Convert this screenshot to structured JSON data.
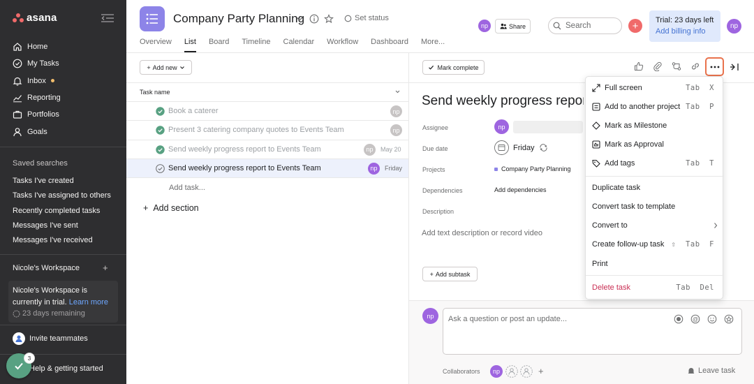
{
  "sidebar": {
    "logo_text": "asana",
    "nav": [
      {
        "label": "Home",
        "icon": "home-icon"
      },
      {
        "label": "My Tasks",
        "icon": "check-circle-icon"
      },
      {
        "label": "Inbox",
        "icon": "bell-icon"
      },
      {
        "label": "Reporting",
        "icon": "chart-icon"
      },
      {
        "label": "Portfolios",
        "icon": "portfolio-icon"
      },
      {
        "label": "Goals",
        "icon": "person-icon"
      }
    ],
    "saved_searches_title": "Saved searches",
    "saved_searches": [
      "Tasks I've created",
      "Tasks I've assigned to others",
      "Recently completed tasks",
      "Messages I've sent",
      "Messages I've received"
    ],
    "workspace_title": "Nicole's Workspace",
    "trial_text_1": "Nicole's Workspace is",
    "trial_text_2": "currently in trial.",
    "learn_more": "Learn more",
    "days_remaining": "23 days remaining",
    "invite": "Invite teammates",
    "help": "Help & getting started",
    "check_badge": "3"
  },
  "header": {
    "project_title": "Company Party Planning",
    "set_status": "Set status",
    "tabs": [
      "Overview",
      "List",
      "Board",
      "Timeline",
      "Calendar",
      "Workflow",
      "Dashboard",
      "More..."
    ],
    "active_tab": "List",
    "avatar_initials": "np",
    "share": "Share",
    "search_placeholder": "Search",
    "trial_line": "Trial: 23 days left",
    "billing_link": "Add billing info"
  },
  "list": {
    "add_new": "Add new",
    "column_header": "Task name",
    "tasks": [
      {
        "name": "Book a caterer",
        "avatar": "np",
        "date": ""
      },
      {
        "name": "Present 3 catering company quotes to Events Team",
        "avatar": "np",
        "date": ""
      },
      {
        "name": "Send weekly progress report to Events Team",
        "avatar": "np",
        "date": "May 20"
      },
      {
        "name": "Send weekly progress report to Events Team",
        "avatar": "np",
        "date": "Friday"
      }
    ],
    "add_task": "Add task...",
    "add_section": "Add section"
  },
  "detail": {
    "mark_complete": "Mark complete",
    "title": "Send weekly progress report to Events Team",
    "assignee_label": "Assignee",
    "assignee_avatar": "np",
    "due_label": "Due date",
    "due_value": "Friday",
    "projects_label": "Projects",
    "project_value": "Company Party Planning",
    "dependencies_label": "Dependencies",
    "dependencies_value": "Add dependencies",
    "description_label": "Description",
    "description_placeholder": "Add text description or record video",
    "add_subtask": "Add subtask",
    "comment_avatar": "np",
    "comment_placeholder": "Ask a question or post an update...",
    "collaborators_label": "Collaborators",
    "leave_task": "Leave task"
  },
  "menu": {
    "items": [
      {
        "label": "Full screen",
        "shortcut": "Tab  X",
        "icon": "expand-icon"
      },
      {
        "label": "Add to another project",
        "shortcut": "Tab  P",
        "icon": "project-icon"
      },
      {
        "label": "Mark as Milestone",
        "shortcut": "",
        "icon": "milestone-icon"
      },
      {
        "label": "Mark as Approval",
        "shortcut": "",
        "icon": "approval-icon"
      },
      {
        "label": "Add tags",
        "shortcut": "Tab  T",
        "icon": "tag-icon"
      },
      {
        "label": "Duplicate task",
        "shortcut": ""
      },
      {
        "label": "Convert task to template",
        "shortcut": ""
      },
      {
        "label": "Convert to",
        "shortcut": ""
      },
      {
        "label": "Create follow-up task",
        "shortcut": "⇧  Tab  F"
      },
      {
        "label": "Print",
        "shortcut": ""
      },
      {
        "label": "Delete task",
        "shortcut": "Tab  Del"
      }
    ]
  },
  "colors": {
    "sidebar_bg": "#2e2e30",
    "accent_coral": "#f06a6a",
    "project_purple": "#8d84e8",
    "avatar_purple": "#9e65e0",
    "complete_green": "#58a182",
    "highlight_orange": "#e9724c",
    "danger_red": "#c92f54"
  }
}
